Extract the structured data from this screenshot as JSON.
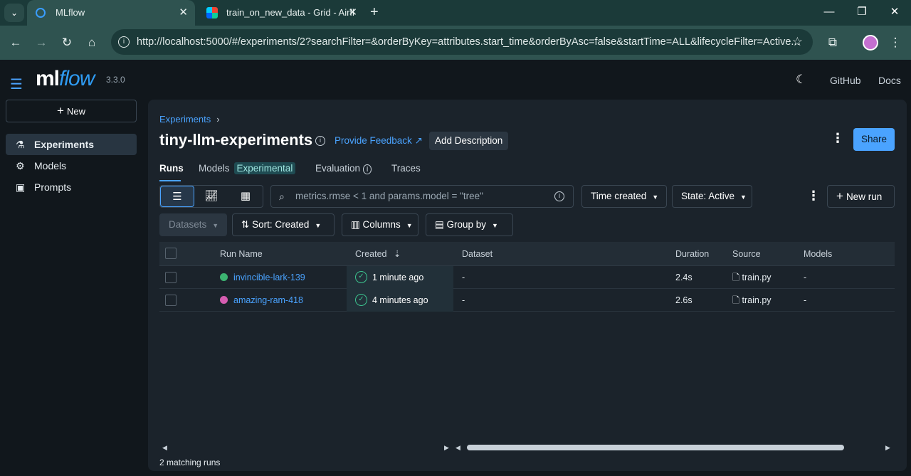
{
  "browser": {
    "tabs": [
      {
        "title": "MLflow",
        "close": "✕"
      },
      {
        "title": "train_on_new_data - Grid - Airfl",
        "close": "✕"
      }
    ],
    "new_tab": "+",
    "window_controls": {
      "minimize": "—",
      "restore": "❐",
      "close": "✕"
    },
    "url": "http://localhost:5000/#/experiments/2?searchFilter=&orderByKey=attributes.start_time&orderByAsc=false&startTime=ALL&lifecycleFilter=Active..."
  },
  "header": {
    "logo_ml": "ml",
    "logo_flow": "flow",
    "version": "3.3.0",
    "links": {
      "github": "GitHub",
      "docs": "Docs"
    }
  },
  "sidebar": {
    "new_label": "New",
    "items": [
      {
        "label": "Experiments",
        "active": true
      },
      {
        "label": "Models"
      },
      {
        "label": "Prompts"
      }
    ]
  },
  "experiment": {
    "breadcrumb": "Experiments",
    "breadcrumb_sep": "›",
    "title": "tiny-llm-experiments",
    "feedback": "Provide Feedback",
    "add_description": "Add Description",
    "share": "Share",
    "tabs": {
      "runs": "Runs",
      "models": "Models",
      "models_badge": "Experimental",
      "evaluation": "Evaluation",
      "traces": "Traces"
    }
  },
  "controls": {
    "search_placeholder": "metrics.rmse < 1 and params.model = \"tree\"",
    "time_filter": "Time created",
    "state_filter": "State: Active",
    "new_run": "New run",
    "datasets": "Datasets",
    "sort": "Sort: Created",
    "columns": "Columns",
    "group_by": "Group by"
  },
  "table": {
    "columns": [
      "Run Name",
      "Created",
      "Dataset",
      "Duration",
      "Source",
      "Models"
    ],
    "rows": [
      {
        "name": "invincible-lark-139",
        "color": "#3cb371",
        "created": "1 minute ago",
        "dataset": "-",
        "duration": "2.4s",
        "source": "train.py",
        "models": "-"
      },
      {
        "name": "amazing-ram-418",
        "color": "#d65db1",
        "created": "4 minutes ago",
        "dataset": "-",
        "duration": "2.6s",
        "source": "train.py",
        "models": "-"
      }
    ],
    "footer": "2 matching runs"
  }
}
